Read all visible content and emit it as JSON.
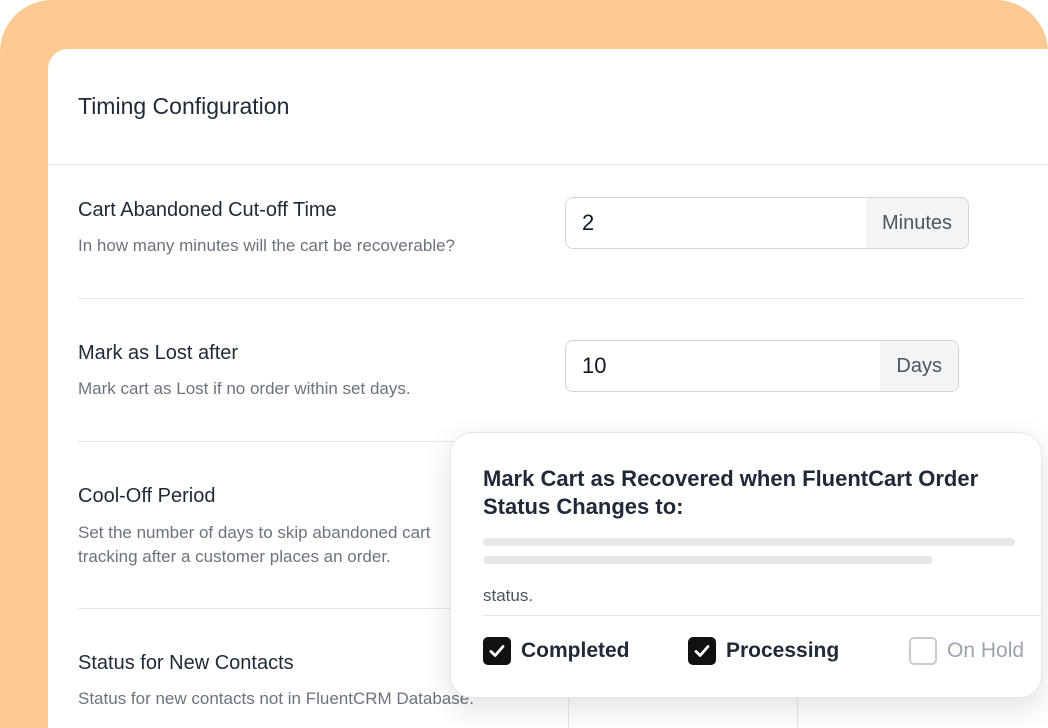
{
  "card": {
    "title": "Timing Configuration"
  },
  "settings": [
    {
      "title": "Cart Abandoned Cut-off Time",
      "description": "In how many minutes will the cart be recoverable?",
      "value": "2",
      "unit": "Minutes"
    },
    {
      "title": "Mark as Lost after",
      "description": "Mark cart as Lost if no order within set days.",
      "value": "10",
      "unit": "Days"
    },
    {
      "title": "Cool-Off Period",
      "description": "Set the number of days to skip abandoned cart tracking after a customer places an order."
    },
    {
      "title": "Status for New Contacts",
      "description": "Status for new contacts not in FluentCRM Database."
    }
  ],
  "popup": {
    "title": "Mark Cart as Recovered when FluentCart Order Status Changes to:",
    "hint": "status.",
    "options": [
      {
        "label": "Completed",
        "checked": true
      },
      {
        "label": "Processing",
        "checked": true
      },
      {
        "label": "On Hold",
        "checked": false
      }
    ]
  },
  "colors": {
    "background": "#fdc993",
    "checkbox_checked": "#111111"
  }
}
